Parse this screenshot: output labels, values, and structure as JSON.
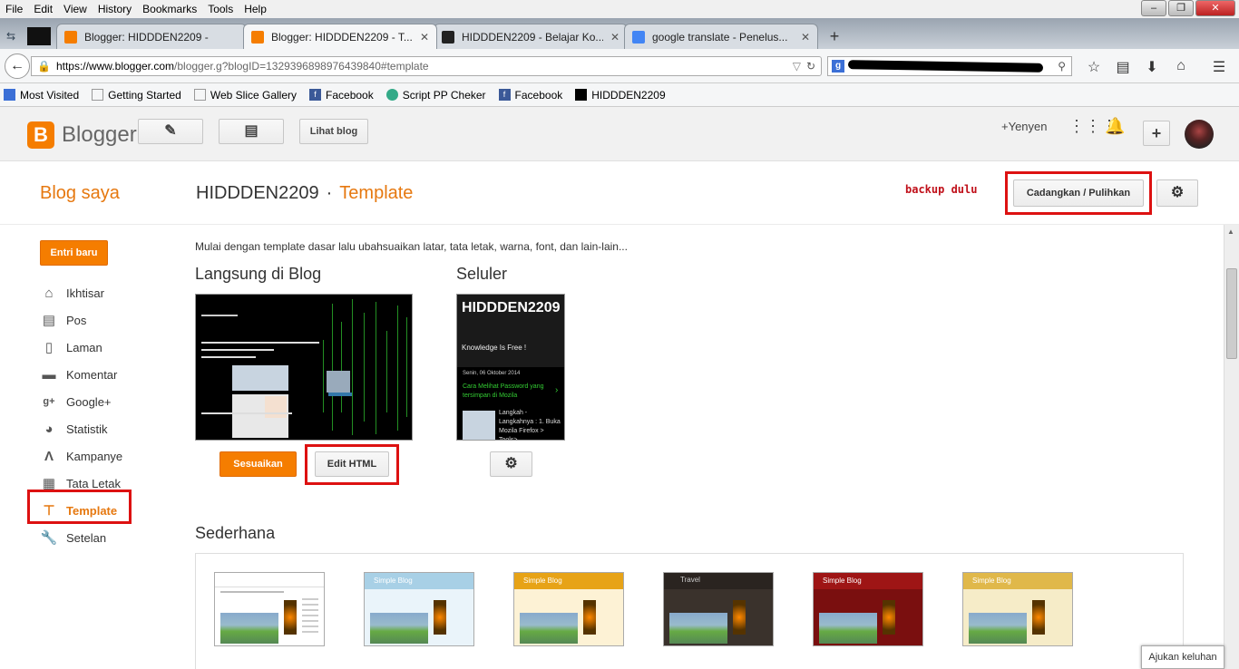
{
  "menubar": [
    "File",
    "Edit",
    "View",
    "History",
    "Bookmarks",
    "Tools",
    "Help"
  ],
  "tabs": [
    {
      "title": "Blogger: HIDDDEN2209 -",
      "color": "#f57d00"
    },
    {
      "title": "Blogger: HIDDDEN2209 - T...",
      "color": "#f57d00"
    },
    {
      "title": "HIDDDEN2209 - Belajar Ko...",
      "color": "#222"
    },
    {
      "title": "google translate - Penelus...",
      "color": "#4285f4"
    }
  ],
  "browser": {
    "url_domain": "https://www.blogger.com",
    "url_rest": "/blogger.g?blogID=1329396898976439840#template"
  },
  "bookmarks": [
    "Most Visited",
    "Getting Started",
    "Web Slice Gallery",
    "Facebook",
    "Script PP Cheker",
    "Facebook",
    "HIDDDEN2209"
  ],
  "header": {
    "brand": "Blogger",
    "lihat_blog": "Lihat blog",
    "user": "+Yenyen"
  },
  "subheader": {
    "blog_saya": "Blog saya",
    "blog_name": "HIDDDEN2209",
    "separator": "·",
    "current": "Template",
    "backup_note": "backup dulu",
    "backup_button": "Cadangkan / Pulihkan"
  },
  "sidebar": {
    "new_post": "Entri baru",
    "items": [
      {
        "label": "Ikhtisar",
        "icon": "home-icon"
      },
      {
        "label": "Pos",
        "icon": "posts-icon"
      },
      {
        "label": "Laman",
        "icon": "pages-icon"
      },
      {
        "label": "Komentar",
        "icon": "comment-icon"
      },
      {
        "label": "Google+",
        "icon": "google-plus-icon"
      },
      {
        "label": "Statistik",
        "icon": "stats-icon"
      },
      {
        "label": "Kampanye",
        "icon": "campaign-icon"
      },
      {
        "label": "Tata Letak",
        "icon": "layout-icon"
      },
      {
        "label": "Template",
        "icon": "template-icon"
      },
      {
        "label": "Setelan",
        "icon": "wrench-icon"
      }
    ]
  },
  "main": {
    "intro": "Mulai dengan template dasar lalu ubahsuaikan latar, tata letak, warna, font, dan lain-lain...",
    "live_heading": "Langsung di Blog",
    "mobile_heading": "Seluler",
    "customize_button": "Sesuaikan",
    "edit_html_button": "Edit HTML",
    "simple_heading": "Sederhana",
    "mobile_preview": {
      "title": "HIDDDEN2209",
      "tagline": "Knowledge Is Free !",
      "date": "Senin, 06 Oktober 2014",
      "post_title": "Cara Melihat Password yang tersimpan di Mozila",
      "excerpt": "Langkah - Langkahnya : 1. Buka Mozila Firefox > Tools>"
    },
    "simple_templates": [
      {
        "label": "",
        "header": "#ffffff",
        "body": "#ffffff"
      },
      {
        "label": "Simple Blog",
        "header": "#a8d0e6",
        "body": "#eaf4fa"
      },
      {
        "label": "Simple Blog",
        "header": "#e7a317",
        "body": "#fdf2d5"
      },
      {
        "label": "Travel",
        "header": "#2a2420",
        "body": "#3a322c"
      },
      {
        "label": "Simple Blog",
        "header": "#9e1515",
        "body": "#7a0f0f"
      },
      {
        "label": "Simple Blog",
        "header": "#e0b84a",
        "body": "#f6ecc8"
      }
    ]
  },
  "feedback": "Ajukan keluhan"
}
